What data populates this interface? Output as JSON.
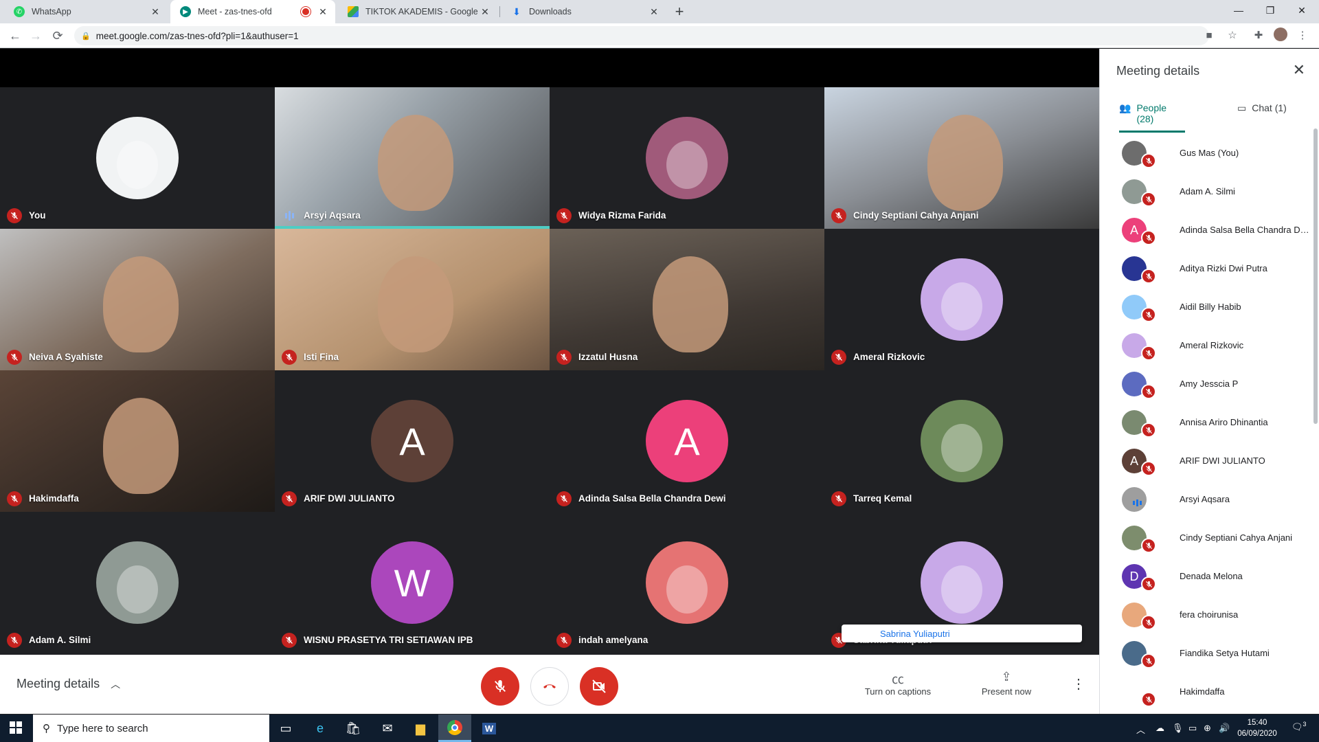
{
  "browser": {
    "tabs": [
      {
        "label": "WhatsApp",
        "icon": "whatsapp-icon",
        "active": false
      },
      {
        "label": "Meet - zas-tnes-ofd",
        "icon": "meet-icon",
        "active": true,
        "recording": true
      },
      {
        "label": "TIKTOK AKADEMIS - Google Drive",
        "icon": "drive-icon",
        "active": false
      },
      {
        "label": "Downloads",
        "icon": "download-icon",
        "active": false
      }
    ],
    "url": "meet.google.com/zas-tnes-ofd?pli=1&authuser=1"
  },
  "tiles": [
    {
      "name": "You",
      "type": "avatar",
      "bg": "#f1f3f4",
      "muted": true
    },
    {
      "name": "Arsyi Aqsara",
      "type": "video",
      "muted": false,
      "speaking": true
    },
    {
      "name": "Widya Rizma Farida",
      "type": "avatar",
      "bg": "#a05a7a",
      "muted": true
    },
    {
      "name": "Cindy Septiani Cahya Anjani",
      "type": "video",
      "muted": true
    },
    {
      "name": "Neiva A Syahiste",
      "type": "video",
      "muted": true
    },
    {
      "name": "Isti Fina",
      "type": "video",
      "muted": true
    },
    {
      "name": "Izzatul Husna",
      "type": "video",
      "muted": true
    },
    {
      "name": "Ameral Rizkovic",
      "type": "avatar",
      "bg": "#c8a9e8",
      "muted": true
    },
    {
      "name": "Hakimdaffa",
      "type": "video",
      "muted": true
    },
    {
      "name": "ARIF DWI JULIANTO",
      "type": "letter",
      "letter": "A",
      "bg": "#5d4037",
      "muted": true
    },
    {
      "name": "Adinda Salsa Bella Chandra Dewi",
      "type": "letter",
      "letter": "A",
      "bg": "#ec407a",
      "muted": true
    },
    {
      "name": "Tarreq Kemal",
      "type": "avatar",
      "bg": "#6d8a5a",
      "muted": true
    },
    {
      "name": "Adam A. Silmi",
      "type": "avatar",
      "bg": "#8f9a94",
      "muted": true
    },
    {
      "name": "WISNU PRASETYA TRI SETIAWAN IPB",
      "type": "letter",
      "letter": "W",
      "bg": "#ab47bc",
      "muted": true
    },
    {
      "name": "indah amelyana",
      "type": "avatar",
      "bg": "#e57373",
      "muted": true
    },
    {
      "name": "Sabrina Yuliaputri",
      "type": "avatar",
      "bg": "#c8a9e8",
      "muted": true
    }
  ],
  "popup": {
    "text": "Sabrina Yuliaputri"
  },
  "bottom": {
    "meeting_details": "Meeting details",
    "captions": "Turn on captions",
    "present": "Present now"
  },
  "panel": {
    "title": "Meeting details",
    "people_tab": "People (28)",
    "chat_tab": "Chat (1)",
    "people": [
      {
        "name": "Gus Mas (You)",
        "bg": "#6d6d6d",
        "letter": "",
        "muted": true
      },
      {
        "name": "Adam A. Silmi",
        "bg": "#8f9a94",
        "letter": "",
        "muted": true
      },
      {
        "name": "Adinda Salsa Bella Chandra De...",
        "bg": "#ec407a",
        "letter": "A",
        "muted": true
      },
      {
        "name": "Aditya Rizki Dwi Putra",
        "bg": "#283593",
        "letter": "",
        "muted": true
      },
      {
        "name": "Aidil Billy Habib",
        "bg": "#90caf9",
        "letter": "",
        "muted": true
      },
      {
        "name": "Ameral Rizkovic",
        "bg": "#c8a9e8",
        "letter": "",
        "muted": true
      },
      {
        "name": "Amy Jesscia P",
        "bg": "#5c6bc0",
        "letter": "",
        "muted": true
      },
      {
        "name": "Annisa Ariro Dhinantia",
        "bg": "#7a8a70",
        "letter": "",
        "muted": true
      },
      {
        "name": "ARIF DWI JULIANTO",
        "bg": "#5d4037",
        "letter": "A",
        "muted": true
      },
      {
        "name": "Arsyi Aqsara",
        "bg": "#9e9e9e",
        "letter": "",
        "muted": false
      },
      {
        "name": "Cindy Septiani Cahya Anjani",
        "bg": "#7d8d6d",
        "letter": "",
        "muted": true
      },
      {
        "name": "Denada Melona",
        "bg": "#5e35b1",
        "letter": "D",
        "muted": true
      },
      {
        "name": "fera choirunisa",
        "bg": "#e8a87c",
        "letter": "",
        "muted": true
      },
      {
        "name": "Fiandika Setya Hutami",
        "bg": "#4a6b8a",
        "letter": "",
        "muted": true
      },
      {
        "name": "Hakimdaffa",
        "bg": "#ffffff",
        "letter": "",
        "muted": true
      }
    ]
  },
  "taskbar": {
    "search_placeholder": "Type here to search",
    "time": "15:40",
    "date": "06/09/2020",
    "notif_count": "3"
  }
}
